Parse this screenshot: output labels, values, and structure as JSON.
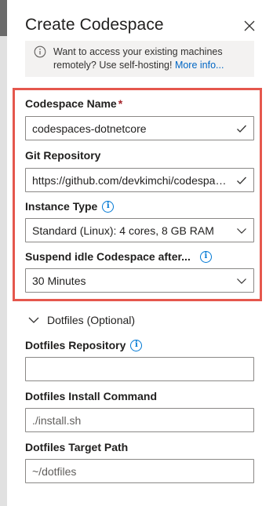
{
  "panel": {
    "title": "Create Codespace",
    "close_icon": "close-icon"
  },
  "info_bar": {
    "message": "Want to access your existing machines remotely? Use self-hosting!",
    "link": "More info..."
  },
  "fields": {
    "codespace_name": {
      "label": "Codespace Name",
      "required_mark": "*",
      "value": "codespaces-dotnetcore"
    },
    "git_repository": {
      "label": "Git Repository",
      "value": "https://github.com/devkimchi/codespaces-dotnetcore"
    },
    "instance_type": {
      "label": "Instance Type",
      "value": "Standard (Linux): 4 cores, 8 GB RAM"
    },
    "suspend_idle": {
      "label": "Suspend idle Codespace after...",
      "value": "30 Minutes"
    }
  },
  "dotfiles": {
    "section_label": "Dotfiles (Optional)",
    "repository": {
      "label": "Dotfiles Repository",
      "value": ""
    },
    "install_command": {
      "label": "Dotfiles Install Command",
      "placeholder": "./install.sh"
    },
    "target_path": {
      "label": "Dotfiles Target Path",
      "placeholder": "~/dotfiles"
    }
  },
  "colors": {
    "accent": "#0078d4",
    "highlight_border": "#e5574d",
    "required": "#a4262c"
  }
}
